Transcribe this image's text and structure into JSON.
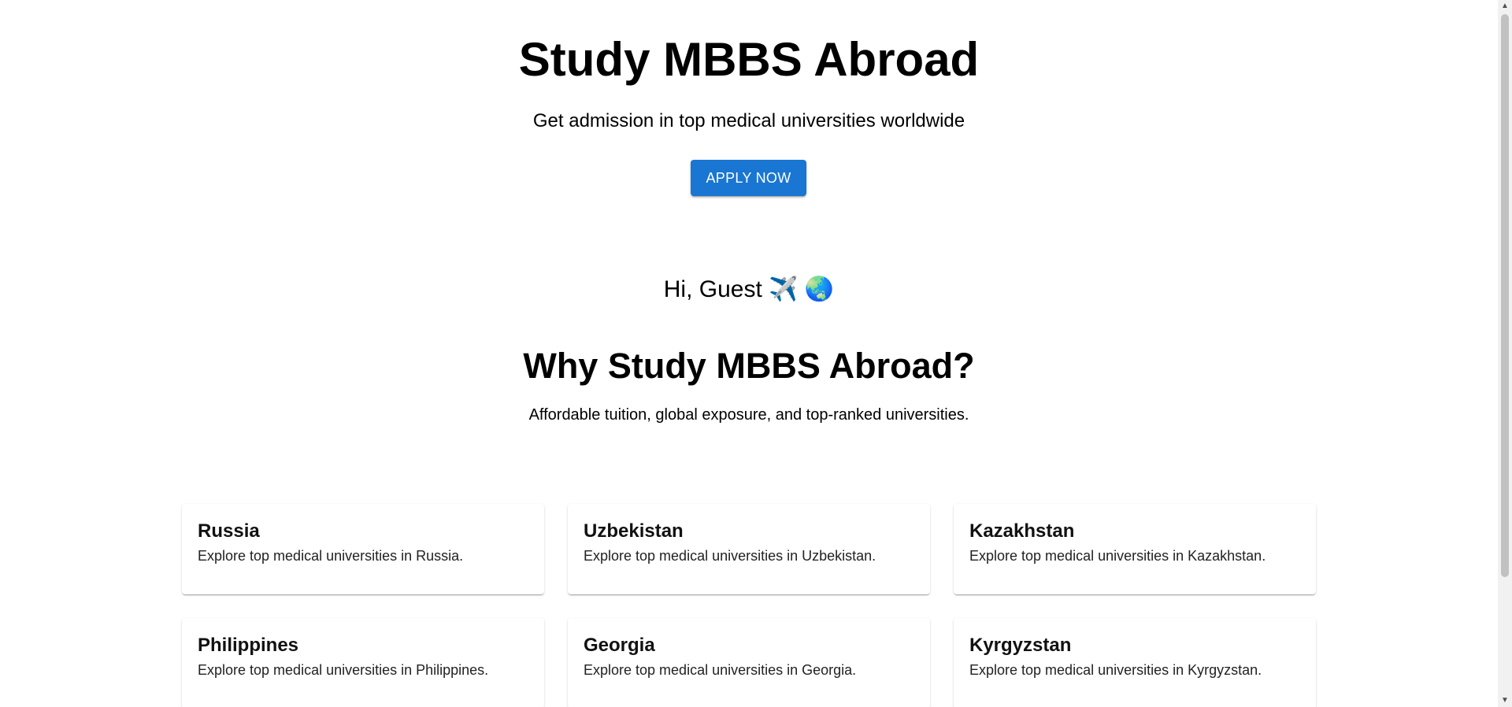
{
  "hero": {
    "title": "Study MBBS Abroad",
    "subtitle": "Get admission in top medical universities worldwide",
    "cta_label": "APPLY NOW",
    "cta_color": "#1976d2"
  },
  "greeting": {
    "text": "Hi, Guest",
    "emoji_airplane": "✈️",
    "emoji_globe": "🌏"
  },
  "why": {
    "title": "Why Study MBBS Abroad?",
    "text": "Affordable tuition, global exposure, and top-ranked universities."
  },
  "countries": [
    {
      "name": "Russia",
      "description": "Explore top medical universities in Russia."
    },
    {
      "name": "Uzbekistan",
      "description": "Explore top medical universities in Uzbekistan."
    },
    {
      "name": "Kazakhstan",
      "description": "Explore top medical universities in Kazakhstan."
    },
    {
      "name": "Philippines",
      "description": "Explore top medical universities in Philippines."
    },
    {
      "name": "Georgia",
      "description": "Explore top medical universities in Georgia."
    },
    {
      "name": "Kyrgyzstan",
      "description": "Explore top medical universities in Kyrgyzstan."
    }
  ],
  "scrollbar": {
    "up_arrow": "▲",
    "down_arrow": "▼"
  }
}
